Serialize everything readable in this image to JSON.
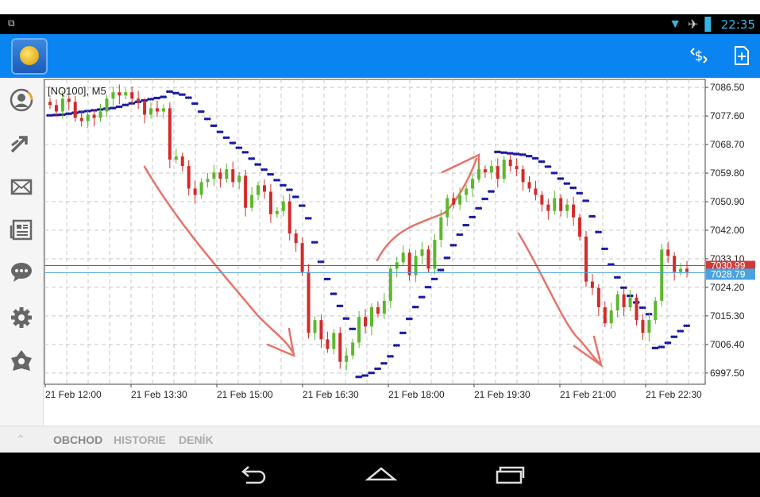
{
  "status_bar": {
    "time": "22:35"
  },
  "app_bar": {
    "logo_icon": "metatrader-logo-icon",
    "actions": [
      "quotes-icon",
      "new-order-icon"
    ]
  },
  "sidebar": {
    "items": [
      "account-icon",
      "trade-icon",
      "mail-icon",
      "news-icon",
      "chat-icon",
      "settings-icon",
      "community-icon"
    ]
  },
  "chart": {
    "symbol_label": "[NQ100], M5",
    "bid_price": "7028.79",
    "ask_price": "7030.99",
    "bid_color": "#4aa3df",
    "ask_color": "#d23a3a",
    "bull_color": "#5cb82c",
    "bear_color": "#d42a2a",
    "psar_color": "#1a1aa8",
    "annotation_color": "#e8736a"
  },
  "chart_data": {
    "type": "candlestick",
    "symbol": "NQ100",
    "timeframe": "M5",
    "y_ticks": [
      "7086.50",
      "7077.60",
      "7068.70",
      "7059.80",
      "7050.90",
      "7042.00",
      "7033.10",
      "7024.20",
      "7015.30",
      "7006.40",
      "6997.50"
    ],
    "x_ticks": [
      "21 Feb 12:00",
      "21 Feb 13:30",
      "21 Feb 15:00",
      "21 Feb 16:30",
      "21 Feb 18:00",
      "21 Feb 19:30",
      "21 Feb 21:00",
      "21 Feb 22:30"
    ],
    "ylim": [
      6994.0,
      7089.0
    ],
    "current_bid": 7028.79,
    "candles_close": [
      7081,
      7079,
      7083,
      7082,
      7077,
      7076,
      7078,
      7077,
      7079,
      7083,
      7085,
      7084,
      7085,
      7083,
      7082,
      7078,
      7080,
      7079,
      7080,
      7064,
      7065,
      7062,
      7055,
      7053,
      7057,
      7058,
      7060,
      7058,
      7061,
      7057,
      7059,
      7049,
      7053,
      7056,
      7054,
      7047,
      7048,
      7051,
      7041,
      7038,
      7029,
      7010,
      7014,
      7008,
      7005,
      7010,
      7001,
      7003,
      7007,
      7015,
      7012,
      7018,
      7016,
      7020,
      7030,
      7032,
      7035,
      7028,
      7034,
      7036,
      7030,
      7039,
      7046,
      7052,
      7050,
      7053,
      7055,
      7058,
      7061,
      7060,
      7062,
      7058,
      7064,
      7062,
      7061,
      7057,
      7055,
      7053,
      7050,
      7048,
      7052,
      7048,
      7050,
      7046,
      7040,
      7026,
      7024,
      7018,
      7013,
      7017,
      7022,
      7018,
      7021,
      7014,
      7010,
      7014,
      7020,
      7036,
      7034,
      7029,
      7030,
      7029
    ]
  },
  "bottom_tabs": [
    "OBCHOD",
    "HISTORIE",
    "DENÍK"
  ]
}
